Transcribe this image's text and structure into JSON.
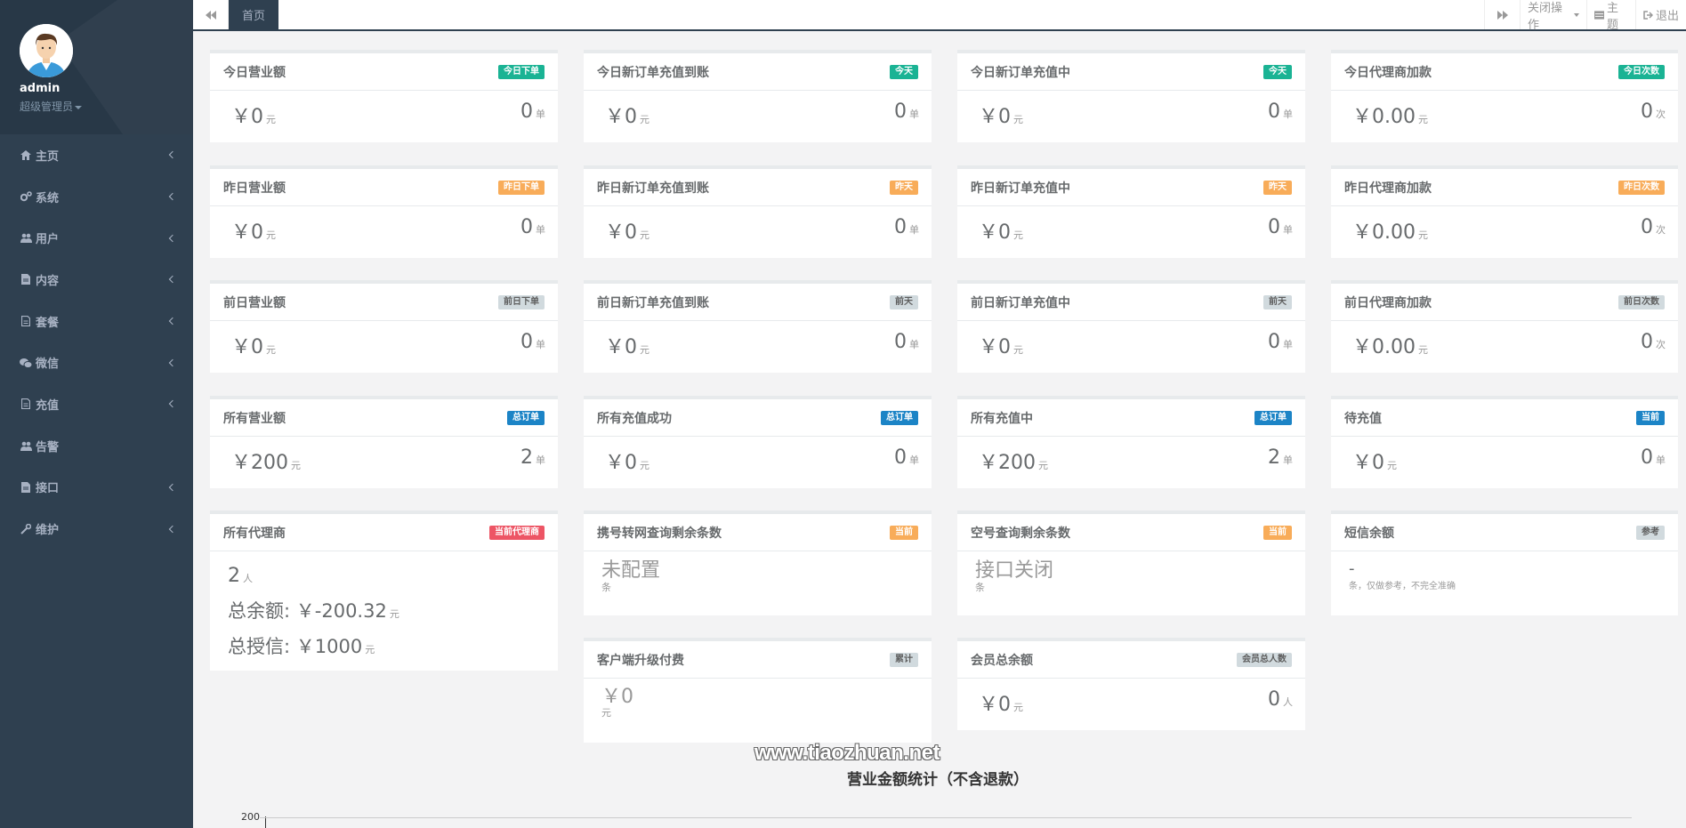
{
  "sidebar": {
    "user": {
      "name": "admin",
      "role": "超级管理员"
    },
    "items": [
      {
        "label": "主页",
        "icon": "home-icon",
        "has_children": true
      },
      {
        "label": "系统",
        "icon": "cogs-icon",
        "has_children": true
      },
      {
        "label": "用户",
        "icon": "users-icon",
        "has_children": true
      },
      {
        "label": "内容",
        "icon": "file-icon",
        "has_children": true
      },
      {
        "label": "套餐",
        "icon": "file-text-icon",
        "has_children": true
      },
      {
        "label": "微信",
        "icon": "wechat-icon",
        "has_children": true
      },
      {
        "label": "充值",
        "icon": "file-text-icon",
        "has_children": true
      },
      {
        "label": "告警",
        "icon": "users-icon",
        "has_children": false
      },
      {
        "label": "接口",
        "icon": "file-text-icon",
        "has_children": true
      },
      {
        "label": "维护",
        "icon": "wrench-icon",
        "has_children": true
      }
    ]
  },
  "topbar": {
    "active_tab": "首页",
    "close_ops": "关闭操作",
    "theme": "主题",
    "logout": "退出"
  },
  "cards": {
    "r1c1": {
      "title": "今日营业额",
      "badge": "今日下单",
      "left_value": "￥0",
      "left_unit": "元",
      "right_value": "0",
      "right_unit": "单"
    },
    "r1c2": {
      "title": "今日新订单充值到账",
      "badge": "今天",
      "left_value": "￥0",
      "left_unit": "元",
      "right_value": "0",
      "right_unit": "单"
    },
    "r1c3": {
      "title": "今日新订单充值中",
      "badge": "今天",
      "left_value": "￥0",
      "left_unit": "元",
      "right_value": "0",
      "right_unit": "单"
    },
    "r1c4": {
      "title": "今日代理商加款",
      "badge": "今日次数",
      "left_value": "￥0.00",
      "left_unit": "元",
      "right_value": "0",
      "right_unit": "次"
    },
    "r2c1": {
      "title": "昨日营业额",
      "badge": "昨日下单",
      "left_value": "￥0",
      "left_unit": "元",
      "right_value": "0",
      "right_unit": "单"
    },
    "r2c2": {
      "title": "昨日新订单充值到账",
      "badge": "昨天",
      "left_value": "￥0",
      "left_unit": "元",
      "right_value": "0",
      "right_unit": "单"
    },
    "r2c3": {
      "title": "昨日新订单充值中",
      "badge": "昨天",
      "left_value": "￥0",
      "left_unit": "元",
      "right_value": "0",
      "right_unit": "单"
    },
    "r2c4": {
      "title": "昨日代理商加款",
      "badge": "昨日次数",
      "left_value": "￥0.00",
      "left_unit": "元",
      "right_value": "0",
      "right_unit": "次"
    },
    "r3c1": {
      "title": "前日营业额",
      "badge": "前日下单",
      "left_value": "￥0",
      "left_unit": "元",
      "right_value": "0",
      "right_unit": "单"
    },
    "r3c2": {
      "title": "前日新订单充值到账",
      "badge": "前天",
      "left_value": "￥0",
      "left_unit": "元",
      "right_value": "0",
      "right_unit": "单"
    },
    "r3c3": {
      "title": "前日新订单充值中",
      "badge": "前天",
      "left_value": "￥0",
      "left_unit": "元",
      "right_value": "0",
      "right_unit": "单"
    },
    "r3c4": {
      "title": "前日代理商加款",
      "badge": "前日次数",
      "left_value": "￥0.00",
      "left_unit": "元",
      "right_value": "0",
      "right_unit": "次"
    },
    "r4c1": {
      "title": "所有营业额",
      "badge": "总订单",
      "left_value": "￥200",
      "left_unit": "元",
      "right_value": "2",
      "right_unit": "单"
    },
    "r4c2": {
      "title": "所有充值成功",
      "badge": "总订单",
      "left_value": "￥0",
      "left_unit": "元",
      "right_value": "0",
      "right_unit": "单"
    },
    "r4c3": {
      "title": "所有充值中",
      "badge": "总订单",
      "left_value": "￥200",
      "left_unit": "元",
      "right_value": "2",
      "right_unit": "单"
    },
    "r4c4": {
      "title": "待充值",
      "badge": "当前",
      "left_value": "￥0",
      "left_unit": "元",
      "right_value": "0",
      "right_unit": "单"
    },
    "agents": {
      "title": "所有代理商",
      "badge": "当前代理商",
      "count": "2",
      "count_unit": "人",
      "balance_label": "总余额: ",
      "balance_value": "￥-200.32",
      "balance_unit": "元",
      "credit_label": "总授信: ",
      "credit_value": "￥1000",
      "credit_unit": "元"
    },
    "portability": {
      "title": "携号转网查询剩余条数",
      "badge": "当前",
      "value": "未配置",
      "unit": "条"
    },
    "empty_number": {
      "title": "空号查询剩余条数",
      "badge": "当前",
      "value": "接口关闭",
      "unit": "条"
    },
    "sms": {
      "title": "短信余额",
      "badge": "参考",
      "value": "-",
      "note": "条，仅做参考，不完全准确"
    },
    "upgrade": {
      "title": "客户端升级付费",
      "badge": "累计",
      "value": "￥0",
      "unit": "元"
    },
    "member_balance": {
      "title": "会员总余额",
      "badge": "会员总人数",
      "left_value": "￥0",
      "left_unit": "元",
      "right_value": "0",
      "right_unit": "人"
    }
  },
  "chart": {
    "title": "营业金额统计（不含退款）",
    "y_tick_top": "200"
  },
  "watermark": "www.tiaozhuan.net"
}
